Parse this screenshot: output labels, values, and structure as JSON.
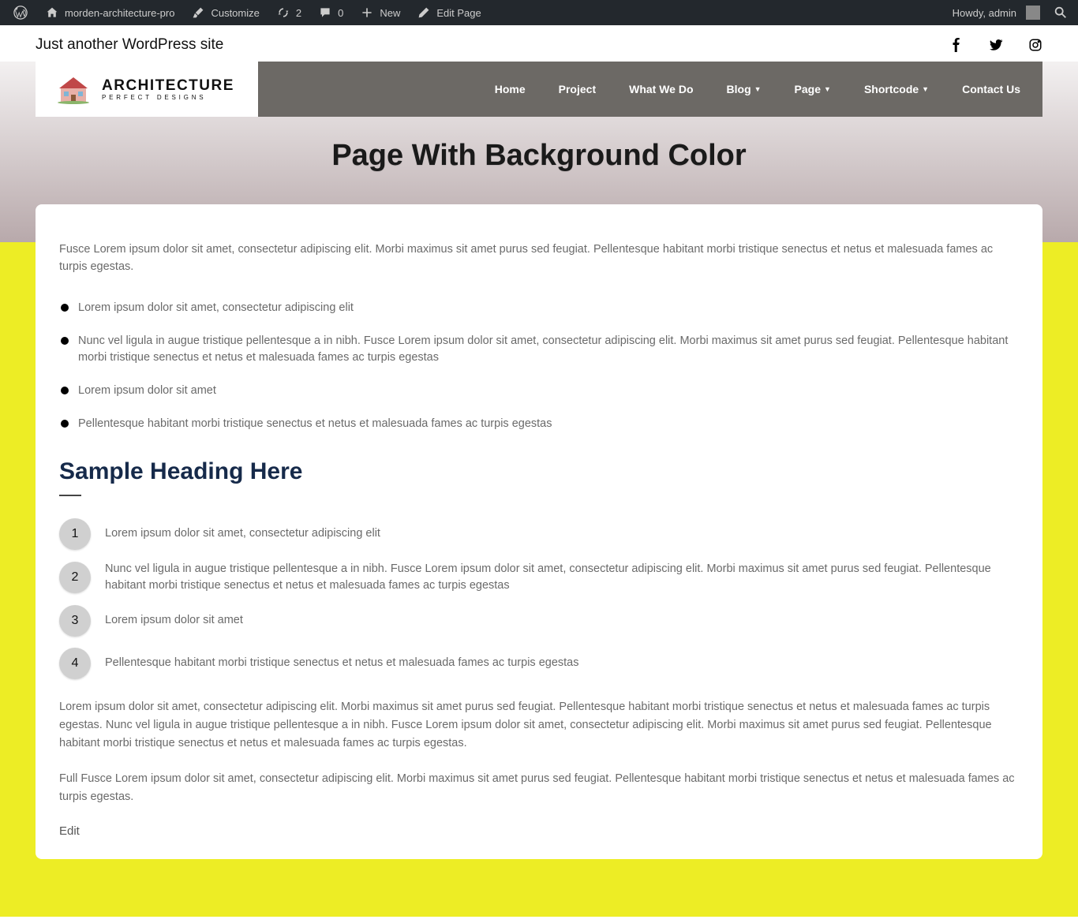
{
  "admin": {
    "site_name": "morden-architecture-pro",
    "customize": "Customize",
    "updates_count": "2",
    "comments_count": "0",
    "new": "New",
    "edit_page": "Edit Page",
    "howdy": "Howdy, admin"
  },
  "tagline": "Just another WordPress site",
  "logo": {
    "title": "ARCHITECTURE",
    "subtitle": "PERFECT DESIGNS"
  },
  "nav": {
    "home": "Home",
    "project": "Project",
    "what_we_do": "What We Do",
    "blog": "Blog",
    "page": "Page",
    "shortcode": "Shortcode",
    "contact": "Contact Us"
  },
  "page_title": "Page With Background Color",
  "content": {
    "intro": "Fusce Lorem ipsum dolor sit amet, consectetur adipiscing elit. Morbi maximus sit amet purus sed feugiat. Pellentesque habitant morbi tristique senectus et netus et malesuada fames ac turpis egestas.",
    "bullets": [
      "Lorem ipsum dolor sit amet, consectetur adipiscing elit",
      "Nunc vel ligula in augue tristique pellentesque a in nibh. Fusce Lorem ipsum dolor sit amet, consectetur adipiscing elit. Morbi maximus sit amet purus sed feugiat. Pellentesque habitant morbi tristique senectus et netus et malesuada fames ac turpis egestas",
      "Lorem ipsum dolor sit amet",
      "Pellentesque habitant morbi tristique senectus et netus et malesuada fames ac turpis egestas"
    ],
    "heading": "Sample Heading Here",
    "numbered": [
      {
        "n": "1",
        "t": "Lorem ipsum dolor sit amet, consectetur adipiscing elit"
      },
      {
        "n": "2",
        "t": "Nunc vel ligula in augue tristique pellentesque a in nibh. Fusce Lorem ipsum dolor sit amet, consectetur adipiscing elit. Morbi maximus sit amet purus sed feugiat. Pellentesque habitant morbi tristique senectus et netus et malesuada fames ac turpis egestas"
      },
      {
        "n": "3",
        "t": "Lorem ipsum dolor sit amet"
      },
      {
        "n": "4",
        "t": "Pellentesque habitant morbi tristique senectus et netus et malesuada fames ac turpis egestas"
      }
    ],
    "para1": "Lorem ipsum dolor sit amet, consectetur adipiscing elit. Morbi maximus sit amet purus sed feugiat. Pellentesque habitant morbi tristique senectus et netus et malesuada fames ac turpis egestas. Nunc vel ligula in augue tristique pellentesque a in nibh. Fusce Lorem ipsum dolor sit amet, consectetur adipiscing elit. Morbi maximus sit amet purus sed feugiat. Pellentesque habitant morbi tristique senectus et netus et malesuada fames ac turpis egestas.",
    "para2": "Full Fusce Lorem ipsum dolor sit amet, consectetur adipiscing elit. Morbi maximus sit amet purus sed feugiat. Pellentesque habitant morbi tristique senectus et netus et malesuada fames ac turpis egestas.",
    "edit": "Edit"
  }
}
